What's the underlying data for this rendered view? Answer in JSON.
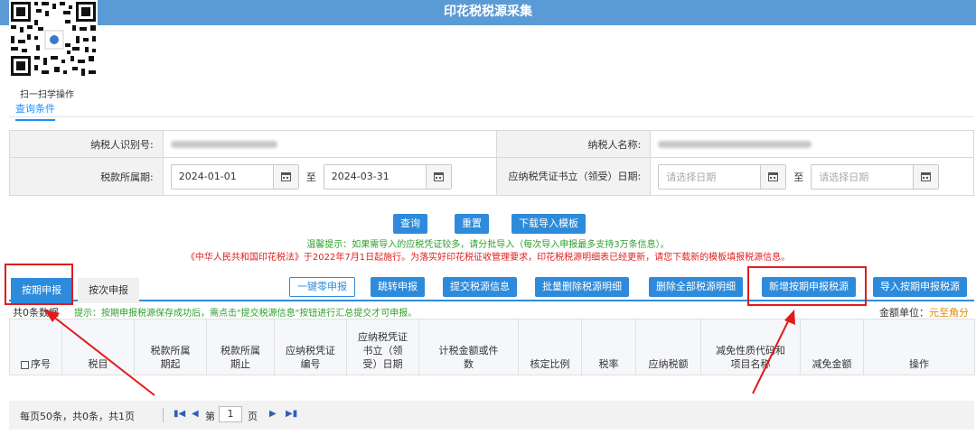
{
  "page": {
    "title": "印花税税源采集"
  },
  "qr": {
    "caption": "扫一扫学操作"
  },
  "query_tab": "查询条件",
  "form": {
    "taxpayer_id_label": "纳税人识别号:",
    "taxpayer_name_label": "纳税人名称:",
    "period_label": "税款所属期:",
    "period_start": "2024-01-01",
    "period_end": "2024-03-31",
    "to_label": "至",
    "voucher_date_label": "应纳税凭证书立（领受）日期:",
    "date_placeholder": "请选择日期"
  },
  "actions": {
    "query": "查询",
    "reset": "重置",
    "download_template": "下载导入模板"
  },
  "tips": {
    "green": "温馨提示：如果需导入的应税凭证较多，请分批导入（每次导入申报最多支持3万条信息）。",
    "red": "《中华人民共和国印花税法》于2022年7月1日起施行。为落实好印花税征收管理要求，印花税税源明细表已经更新，请您下载新的模板填报税源信息。"
  },
  "tabs": {
    "periodic": "按期申报",
    "per_time": "按次申报"
  },
  "toolbar": {
    "zero_declare": "一键零申报",
    "jump_declare": "跳转申报",
    "submit_info": "提交税源信息",
    "batch_delete": "批量删除税源明细",
    "delete_all": "删除全部税源明细",
    "add_periodic": "新增按期申报税源",
    "import_periodic": "导入按期申报税源"
  },
  "status": {
    "count": "共0条数据",
    "hint": "提示：按期申报税源保存成功后，需点击\"提交税源信息\"按钮进行汇总提交才可申报。",
    "unit_label": "金额单位：",
    "unit_value": "元至角分"
  },
  "table": {
    "headers": [
      "序号",
      "税目",
      "税款所属期起",
      "税款所属期止",
      "应纳税凭证编号",
      "应纳税凭证书立（领受）日期",
      "计税金额或件数",
      "核定比例",
      "税率",
      "应纳税额",
      "减免性质代码和项目名称",
      "减免金额",
      "操作"
    ]
  },
  "pager": {
    "info": "每页50条，共0条，共1页",
    "page_prefix": "第",
    "page_value": "1",
    "page_suffix": "页"
  },
  "colors": {
    "header": "#5b9bd5",
    "primary": "#2e8bdb",
    "annotation": "#e01b1b"
  }
}
